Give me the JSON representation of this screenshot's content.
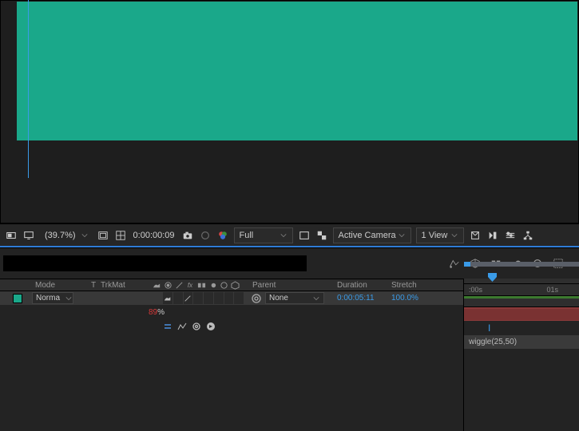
{
  "viewport": {
    "zoom_label": "(39.7%)",
    "timecode": "0:00:00:09",
    "resolution": "Full",
    "camera": "Active Camera",
    "view_count": "1 View"
  },
  "columns": {
    "mode": "Mode",
    "t": "T",
    "trkmat": "TrkMat",
    "parent": "Parent",
    "duration": "Duration",
    "stretch": "Stretch"
  },
  "layer": {
    "mode": "Norma",
    "parent": "None",
    "duration": "0:00:05:11",
    "stretch": "100.0%",
    "opacity_value": "89",
    "opacity_pct": "%",
    "expression": "wiggle(25,50)"
  },
  "timeline": {
    "t0": ":00s",
    "t1": "01s"
  }
}
